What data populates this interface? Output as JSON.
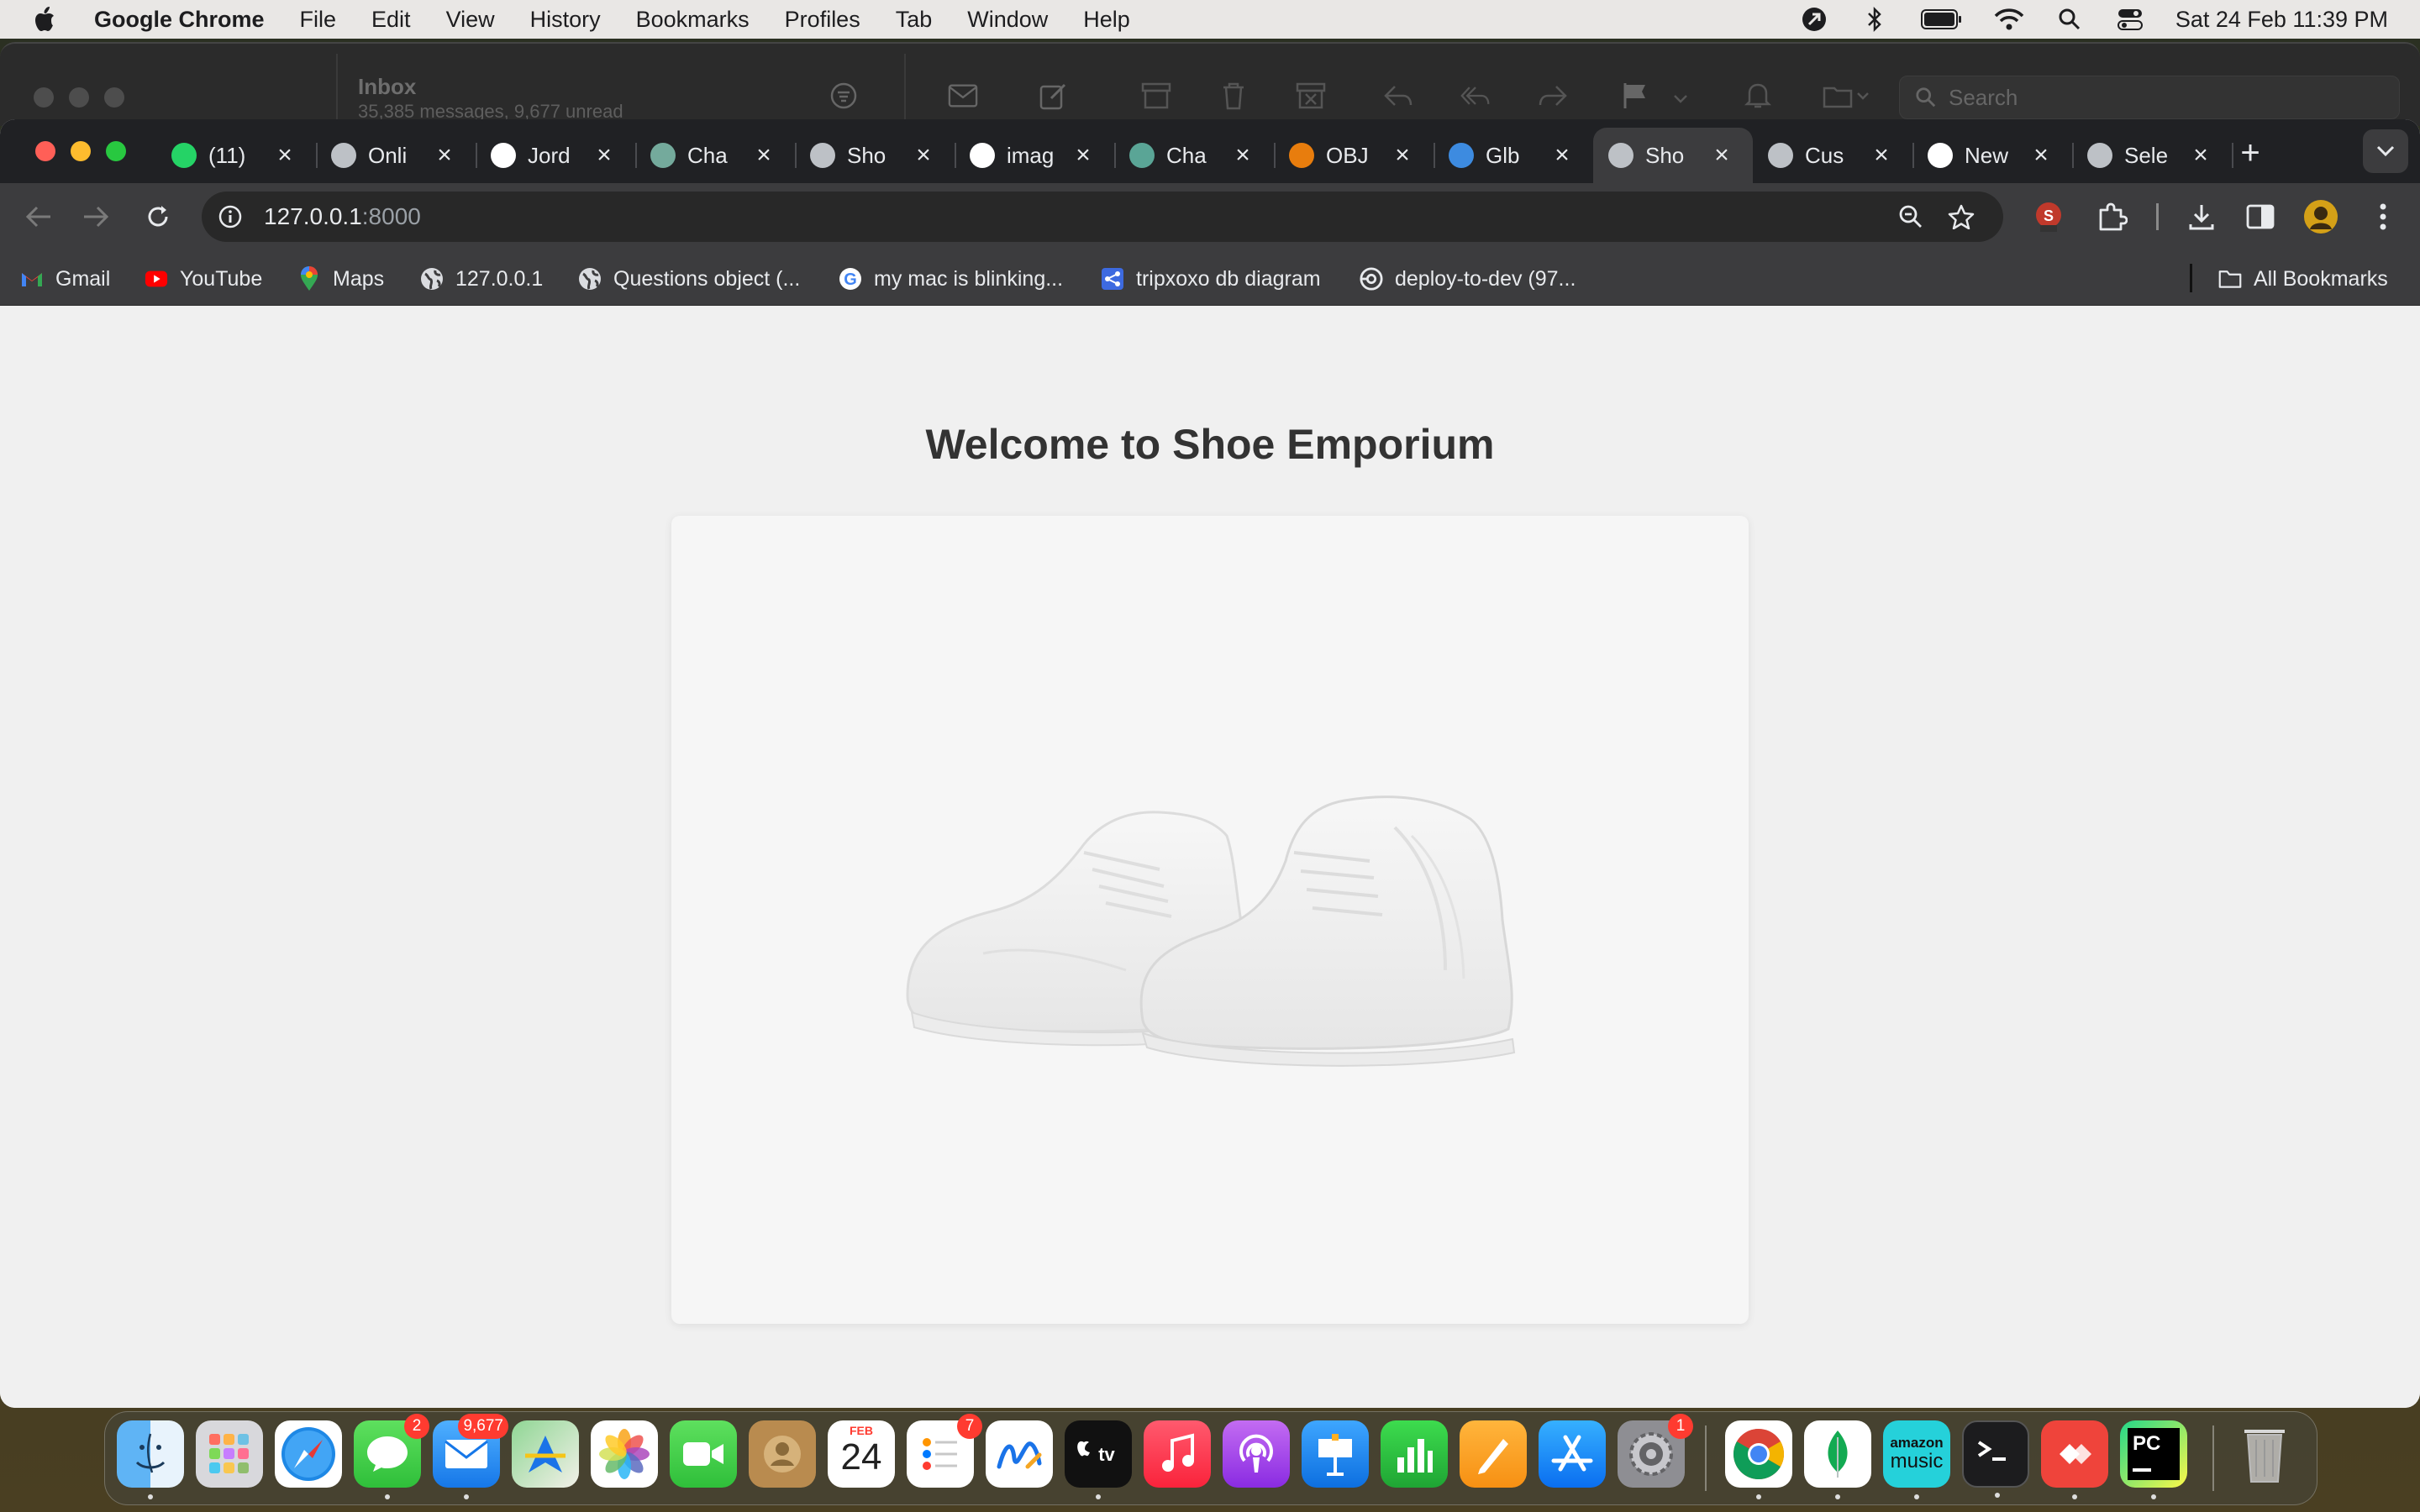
{
  "menubar": {
    "app_name": "Google Chrome",
    "items": [
      "File",
      "Edit",
      "View",
      "History",
      "Bookmarks",
      "Profiles",
      "Tab",
      "Window",
      "Help"
    ],
    "clock": "Sat 24 Feb  11:39 PM"
  },
  "mail": {
    "title": "Inbox",
    "subtitle": "35,385 messages, 9,677 unread",
    "search_placeholder": "Search"
  },
  "tabs": [
    {
      "label": "(11)",
      "icon": "whatsapp-icon",
      "color": "#25d366"
    },
    {
      "label": "Onli",
      "icon": "globe-icon",
      "color": "#bdc1c6"
    },
    {
      "label": "Jord",
      "icon": "nike-icon",
      "color": "#ffffff"
    },
    {
      "label": "Cha",
      "icon": "chatgpt-icon",
      "color": "#74aa9c"
    },
    {
      "label": "Sho",
      "icon": "globe-icon",
      "color": "#bdc1c6"
    },
    {
      "label": "imag",
      "icon": "google-icon",
      "color": "#ffffff"
    },
    {
      "label": "Cha",
      "icon": "chat-app-icon",
      "color": "#5aa596"
    },
    {
      "label": "OBJ",
      "icon": "blender-icon",
      "color": "#e87d0d"
    },
    {
      "label": "Glb",
      "icon": "cube-icon",
      "color": "#3d8be0"
    },
    {
      "label": "Sho",
      "icon": "globe-icon",
      "color": "#bdc1c6",
      "active": true
    },
    {
      "label": "Cus",
      "icon": "globe-icon",
      "color": "#bdc1c6"
    },
    {
      "label": "New",
      "icon": "chrome-icon",
      "color": "#ffffff"
    },
    {
      "label": "Sele",
      "icon": "globe-icon",
      "color": "#bdc1c6"
    }
  ],
  "omnibox": {
    "host": "127.0.0.1",
    "port": ":8000"
  },
  "bookmarks": [
    {
      "label": "Gmail",
      "icon": "gmail-icon"
    },
    {
      "label": "YouTube",
      "icon": "youtube-icon"
    },
    {
      "label": "Maps",
      "icon": "maps-icon"
    },
    {
      "label": "127.0.0.1",
      "icon": "globe-icon"
    },
    {
      "label": "Questions object (...",
      "icon": "globe-icon"
    },
    {
      "label": "my mac is blinking...",
      "icon": "google-icon"
    },
    {
      "label": "tripxoxo db diagram",
      "icon": "diagram-icon"
    },
    {
      "label": "deploy-to-dev (97...",
      "icon": "pipeline-icon"
    }
  ],
  "all_bookmarks_label": "All Bookmarks",
  "page": {
    "title": "Welcome to Shoe Emporium"
  },
  "dock": {
    "calendar_month": "FEB",
    "calendar_day": "24",
    "amazon_music_line1": "amazon",
    "amazon_music_line2": "music",
    "badges": {
      "messages": "2",
      "mail": "9,677",
      "reminders": "7",
      "settings": "1"
    },
    "pycharm_label": "PC"
  },
  "colors": {
    "chrome_dark": "#202124",
    "chrome_toolbar": "#3c3c3e",
    "page_bg": "#f0f0f0",
    "title_text": "#333333"
  }
}
